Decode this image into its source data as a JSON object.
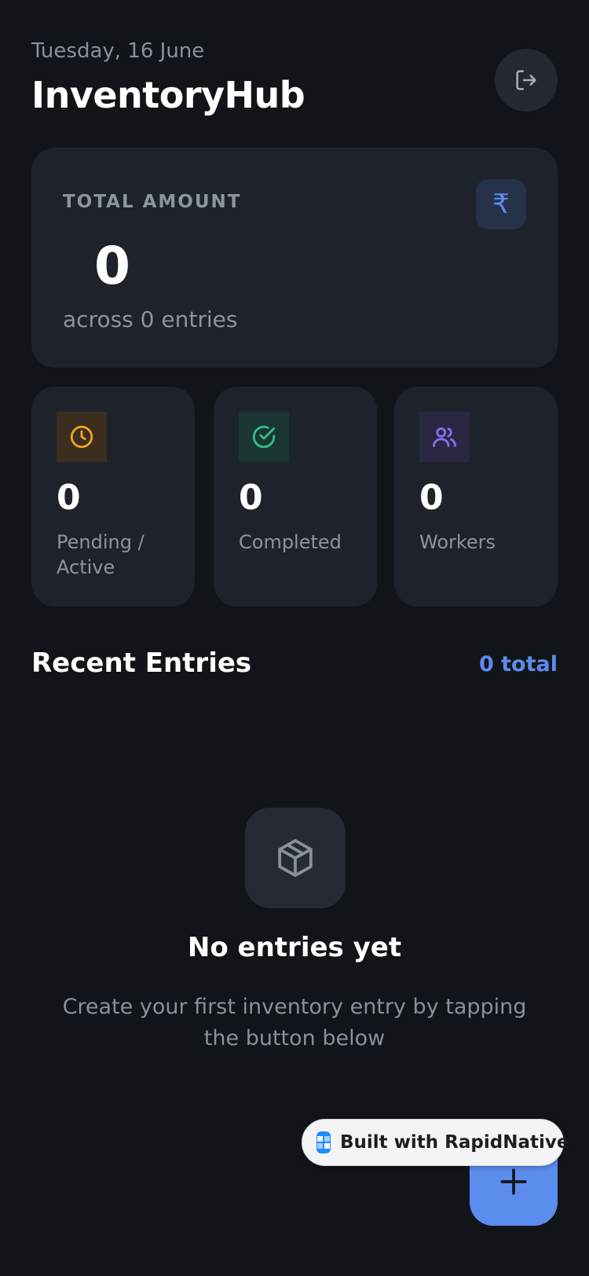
{
  "header": {
    "date": "Tuesday, 16 June",
    "title": "InventoryHub",
    "logout_icon": "logout-icon"
  },
  "summary": {
    "label": "TOTAL AMOUNT",
    "value": "0",
    "subtitle": "across 0 entries",
    "icon": "rupee-icon",
    "icon_glyph": "₹",
    "accent": "#5b8def"
  },
  "stats": [
    {
      "value": "0",
      "label": "Pending / Active",
      "icon": "clock-icon",
      "color": "#f2a51a"
    },
    {
      "value": "0",
      "label": "Completed",
      "icon": "check-circle-icon",
      "color": "#2fbf8a"
    },
    {
      "value": "0",
      "label": "Workers",
      "icon": "users-icon",
      "color": "#8b6cf0"
    }
  ],
  "recent": {
    "title": "Recent Entries",
    "count": "0 total"
  },
  "empty_state": {
    "icon": "package-icon",
    "title": "No entries yet",
    "description": "Create your first inventory entry by tapping the button below"
  },
  "fab": {
    "icon": "plus-icon",
    "color": "#5b8def"
  },
  "badge": {
    "text": "Built with RapidNative"
  }
}
